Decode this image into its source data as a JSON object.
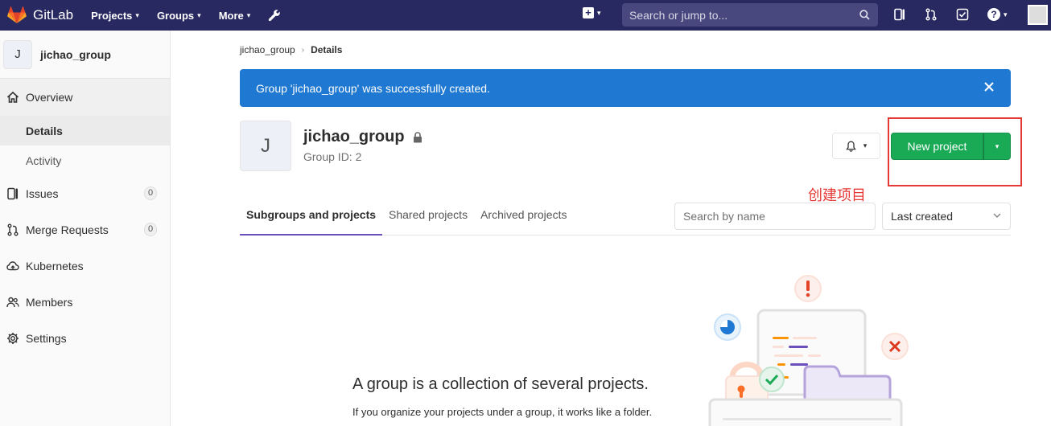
{
  "topnav": {
    "brand": "GitLab",
    "menu": [
      "Projects",
      "Groups",
      "More"
    ],
    "search_placeholder": "Search or jump to..."
  },
  "sidebar": {
    "group_initial": "J",
    "group_name": "jichao_group",
    "overview": "Overview",
    "details": "Details",
    "activity": "Activity",
    "issues": "Issues",
    "issues_count": "0",
    "merge_requests": "Merge Requests",
    "merge_requests_count": "0",
    "kubernetes": "Kubernetes",
    "members": "Members",
    "settings": "Settings"
  },
  "breadcrumb": {
    "parent": "jichao_group",
    "current": "Details"
  },
  "alert": {
    "message": "Group 'jichao_group' was successfully created."
  },
  "group": {
    "initial": "J",
    "name": "jichao_group",
    "id_text": "Group ID: 2"
  },
  "actions": {
    "new_project": "New project"
  },
  "annotation": "创建项目",
  "tabs": [
    "Subgroups and projects",
    "Shared projects",
    "Archived projects"
  ],
  "filter": {
    "placeholder": "Search by name",
    "sort_value": "Last created"
  },
  "empty_state": {
    "title": "A group is a collection of several projects.",
    "description": "If you organize your projects under a group, it works like a folder."
  },
  "colors": {
    "nav_bg": "#292961",
    "alert_bg": "#1f78d1",
    "new_project_bg": "#1aaa55",
    "tab_active": "#6b4fbb",
    "annotation": "#e53935"
  }
}
